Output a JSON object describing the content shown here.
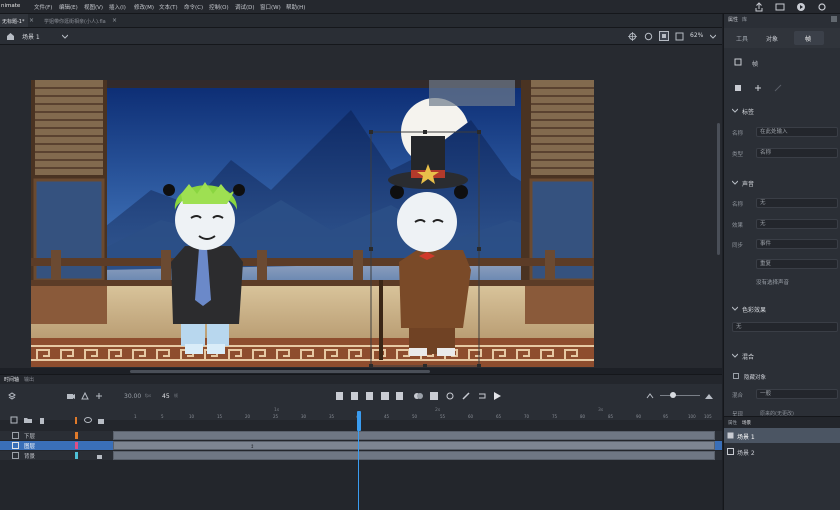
{
  "app": {
    "title": "nimate"
  },
  "menu": [
    "文件(F)",
    "编辑(E)",
    "视图(V)",
    "插入(I)",
    "修改(M)",
    "文本(T)",
    "命令(C)",
    "控制(O)",
    "调试(D)",
    "窗口(W)",
    "帮助(H)"
  ],
  "tabs": {
    "active": "无标题-1*",
    "second": "学姐带你逛街相亲(小人).fla"
  },
  "scene": {
    "name": "场景 1",
    "zoom": "62%"
  },
  "timeline": {
    "tab_main": "时间轴",
    "tab_output": "输出",
    "fps": "30.00",
    "fps_unit": "fps",
    "frame": "45",
    "frame_unit": "帧",
    "ruler_marks": [
      "1",
      "5",
      "10",
      "15",
      "20",
      "25",
      "30",
      "35",
      "40",
      "45",
      "50",
      "55",
      "60",
      "65",
      "70",
      "75",
      "80",
      "85",
      "90",
      "95",
      "100",
      "105"
    ],
    "second_marks": [
      "1s",
      "2s",
      "3s"
    ],
    "layers": [
      {
        "name": "下层",
        "color": "#e07a2a"
      },
      {
        "name": "图层",
        "color": "#e04f86"
      },
      {
        "name": "背景",
        "color": "#4fc1d8"
      }
    ]
  },
  "panel": {
    "tabs": [
      "属性",
      "库"
    ],
    "subtabs": [
      "工具",
      "对象",
      "帧"
    ],
    "active_subtab": "帧",
    "frame_label": "帧",
    "label_section": "标签",
    "name_label": "名称",
    "name_placeholder": "在此处输入",
    "type_label": "类型",
    "type_value": "名称",
    "sound_section": "声音",
    "sound_name_label": "名称",
    "sound_name_value": "无",
    "effect_label": "效果",
    "effect_value": "无",
    "sync_label": "同步",
    "sync_value": "事件",
    "repeat_value": "重复",
    "no_sound": "没有选择声音",
    "color_section": "色彩效果",
    "color_value": "无",
    "blend_section": "混合",
    "blend_check": "隐藏对象",
    "blend_label": "混合",
    "blend_value": "一般",
    "render_label": "呈现",
    "render_value": "原来的(无更改)"
  },
  "library": {
    "tabs": [
      "属性",
      "场景"
    ],
    "scenes": [
      "场景 1",
      "场景 2"
    ]
  },
  "colors": {
    "accent": "#2f86d8",
    "playhead": "#3a9cf0",
    "selected_layer": "#3a6fb8"
  }
}
